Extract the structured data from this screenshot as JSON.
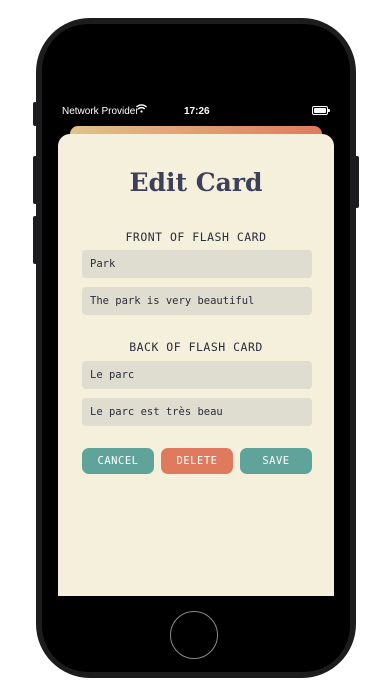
{
  "status_bar": {
    "carrier": "Network Provider",
    "time": "17:26"
  },
  "title": "Edit Card",
  "front": {
    "heading": "FRONT OF FLASH CARD",
    "word": "Park",
    "sentence": "The park is very beautiful"
  },
  "back": {
    "heading": "BACK OF FLASH CARD",
    "word": "Le parc",
    "sentence": "Le parc est très beau"
  },
  "buttons": {
    "cancel": "CANCEL",
    "delete": "DELETE",
    "save": "SAVE"
  },
  "icons": {
    "wifi": "wifi-icon",
    "battery": "battery-icon"
  },
  "colors": {
    "background": "#f4f0dc",
    "title": "#3d405b",
    "teal": "#5fa39a",
    "coral": "#e07a5f",
    "field": "#deddd0"
  }
}
